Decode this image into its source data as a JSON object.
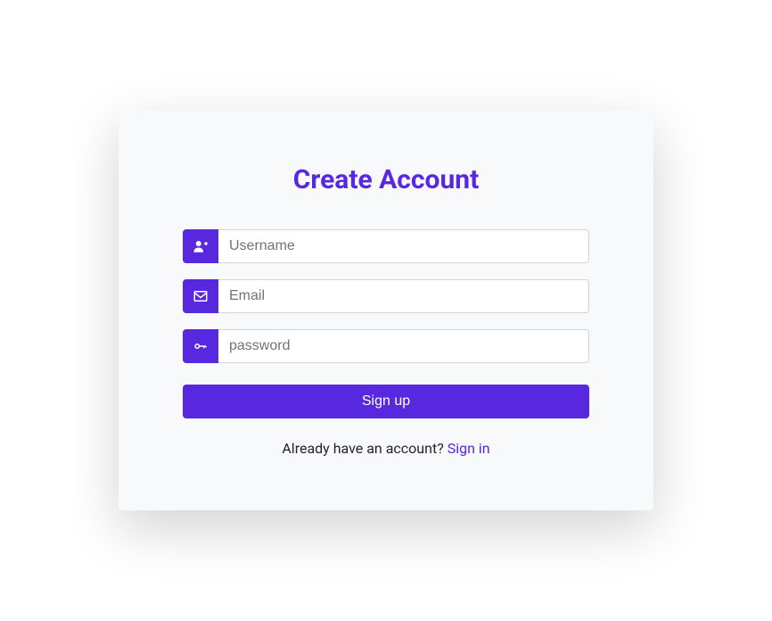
{
  "title": "Create Account",
  "fields": {
    "username": {
      "placeholder": "Username"
    },
    "email": {
      "placeholder": "Email"
    },
    "password": {
      "placeholder": "password"
    }
  },
  "button": {
    "signup": "Sign up"
  },
  "footer": {
    "prompt": "Already have an account? ",
    "link": "Sign in"
  },
  "colors": {
    "accent": "#5827e0"
  }
}
